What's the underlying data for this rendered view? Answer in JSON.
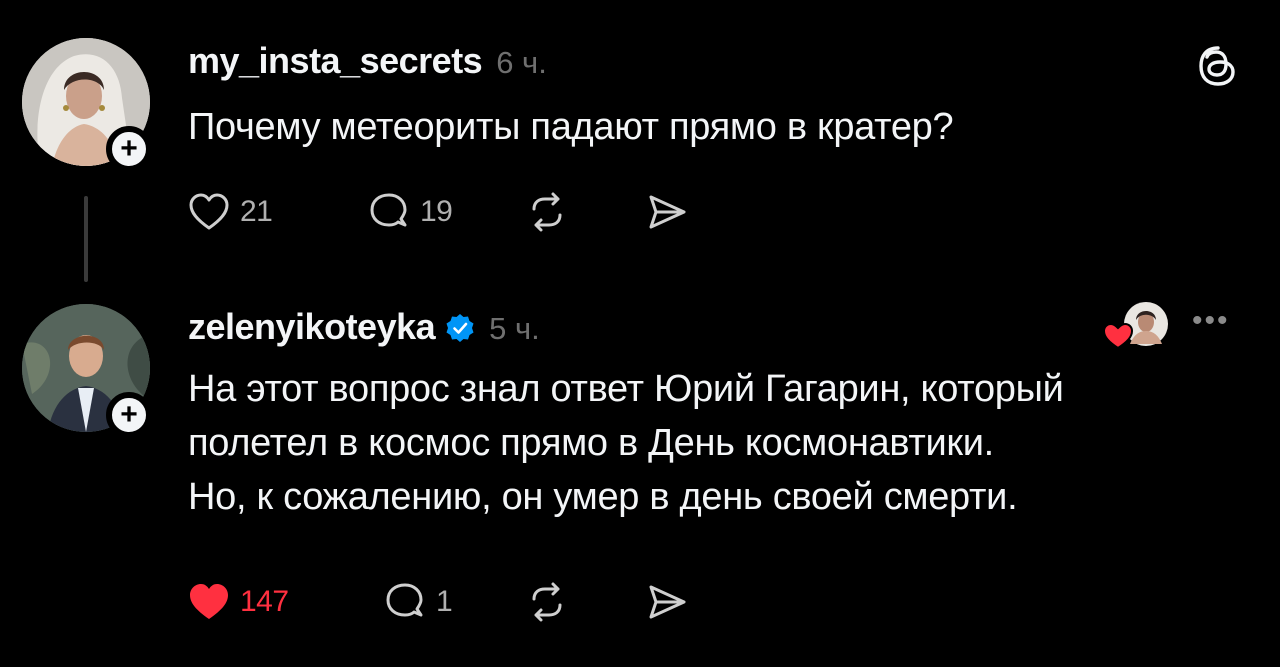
{
  "posts": [
    {
      "username": "my_insta_secrets",
      "time": "6 ч.",
      "text_lines": [
        "Почему метеориты падают прямо в кратер?"
      ],
      "likes": "21",
      "comments": "19",
      "liked": false,
      "verified": false
    },
    {
      "username": "zelenyikoteyka",
      "time": "5 ч.",
      "text_lines": [
        "На этот вопрос знал ответ Юрий Гагарин, который",
        "полетел в космос прямо в День космонавтики.",
        "Но, к сожалению, он умер в день своей смерти."
      ],
      "likes": "147",
      "comments": "1",
      "liked": true,
      "verified": true
    }
  ],
  "colors": {
    "background": "#000000",
    "text": "#f3f5f7",
    "muted": "#6f6f6f",
    "like_red": "#ff3040",
    "verified_blue": "#0095f6"
  },
  "icons": {
    "like": "heart-icon",
    "comment": "comment-bubble-icon",
    "repost": "repost-icon",
    "share": "send-icon",
    "app": "threads-logo-icon",
    "more": "more-horizontal-icon"
  }
}
